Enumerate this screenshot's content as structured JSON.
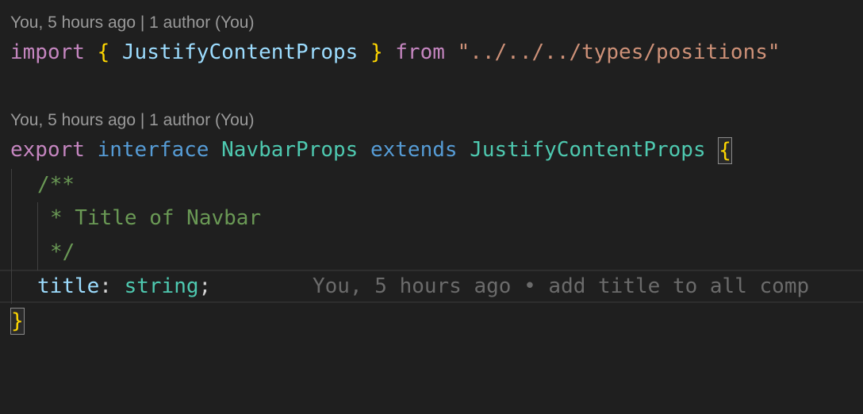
{
  "lens_1": "You, 5 hours ago | 1 author (You)",
  "lens_2": "You, 5 hours ago | 1 author (You)",
  "line_1": {
    "kw_import": "import",
    "brace_open": "{",
    "name": "JustifyContentProps",
    "brace_close": "}",
    "kw_from": "from",
    "path": "\"../../../types/positions\""
  },
  "line_2": {
    "kw_export": "export",
    "kw_interface": "interface",
    "name": "NavbarProps",
    "kw_extends": "extends",
    "base": "JustifyContentProps",
    "brace_open": "{"
  },
  "comment": {
    "open": "/**",
    "text": "* Title of Navbar",
    "close": "*/"
  },
  "prop_line": {
    "name": "title",
    "colon": ":",
    "type": "string",
    "semicolon": ";",
    "inline_blame": "You, 5 hours ago • add title to all comp"
  },
  "closing_brace": "}",
  "colors": {
    "background": "#1f1f1f",
    "keyword_control": "#c586c0",
    "keyword": "#569cd6",
    "type": "#4ec9b0",
    "identifier": "#9cdcfe",
    "string": "#ce9178",
    "bracket": "#ffd700",
    "comment": "#6a9955"
  }
}
